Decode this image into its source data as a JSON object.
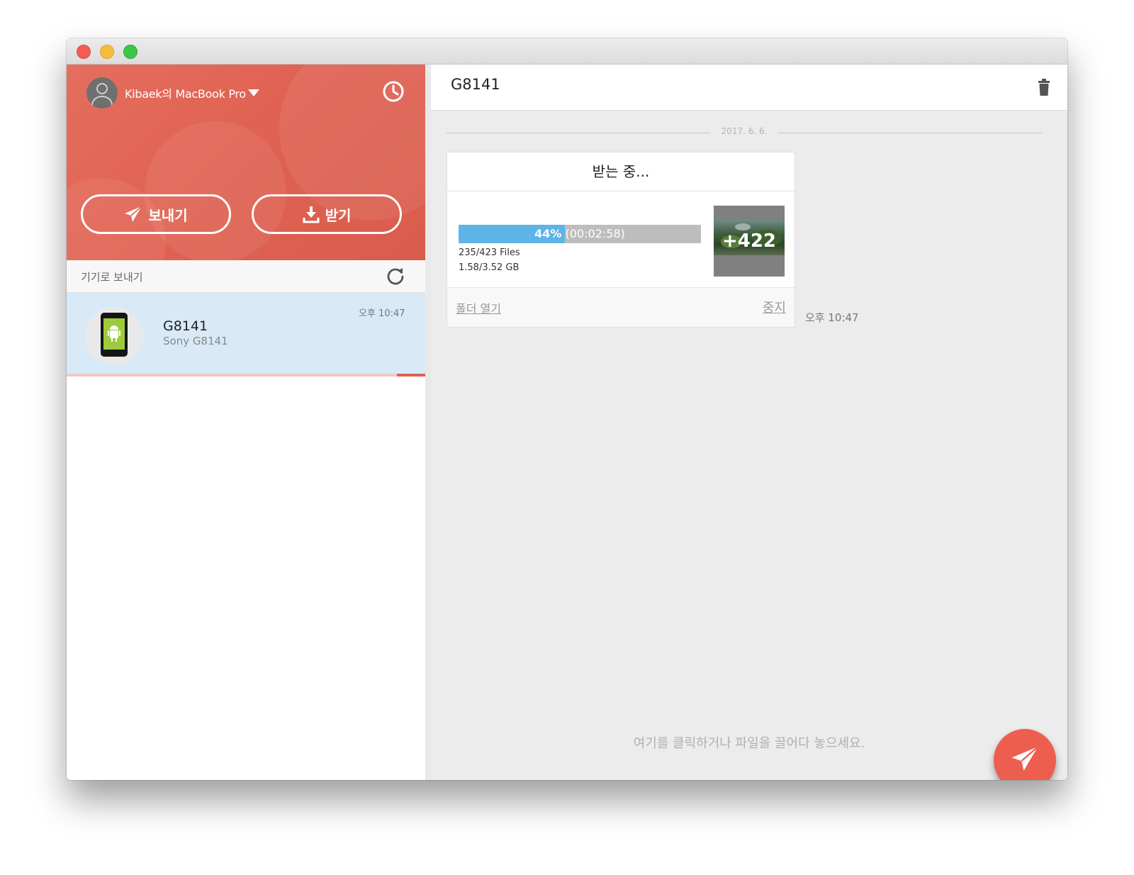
{
  "window": {
    "traffic_lights": [
      "close",
      "minimize",
      "maximize"
    ]
  },
  "sidebar": {
    "device_name": "Kibaek의 MacBook Pro",
    "send_label": "보내기",
    "receive_label": "받기",
    "section_title": "기기로 보내기",
    "devices": [
      {
        "name": "G8141",
        "model": "Sony G8141",
        "time": "오후 10:47",
        "transfer_progress": 0.08
      }
    ]
  },
  "chat": {
    "title": "G8141",
    "date": "2017. 6. 6.",
    "card": {
      "status": "받는 중...",
      "progress_percent": 44,
      "progress_label": "44%",
      "time_remaining": "(00:02:58)",
      "files": "235/423 Files",
      "size": "1.58/3.52 GB",
      "thumbnail_more": "+422",
      "open_folder": "폴더 열기",
      "stop": "중지"
    },
    "message_time": "오후 10:47",
    "drop_hint": "여기를 클릭하거나 파일을 끌어다 놓으세요."
  },
  "colors": {
    "accent": "#e0604f",
    "progress": "#5eb4e6",
    "selected": "#d8eaf7"
  },
  "icons": [
    "history-icon",
    "paper-plane-icon",
    "download-icon",
    "refresh-icon",
    "trash-icon",
    "android-phone-icon",
    "user-avatar-icon",
    "chevron-down-icon"
  ]
}
